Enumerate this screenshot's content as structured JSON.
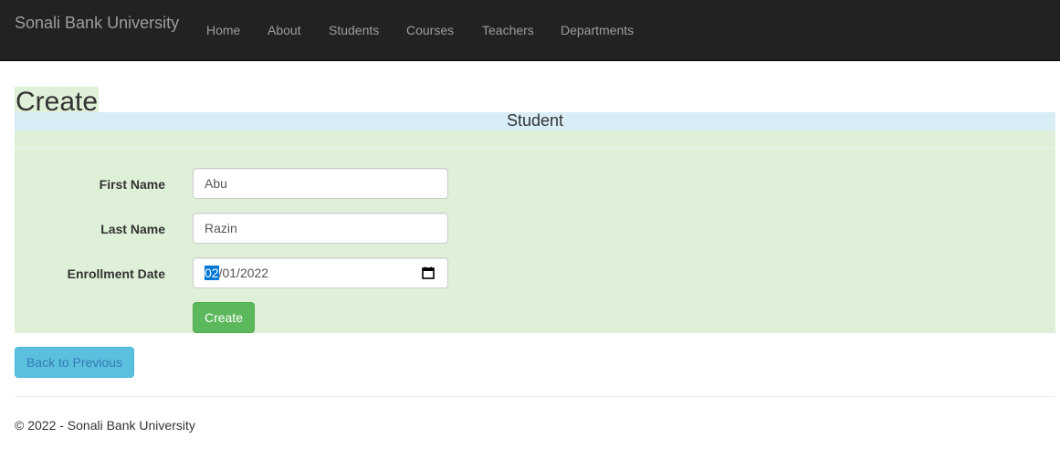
{
  "navbar": {
    "brand": "Sonali Bank University",
    "items": [
      "Home",
      "About",
      "Students",
      "Courses",
      "Teachers",
      "Departments"
    ]
  },
  "page": {
    "title": "Create",
    "panel_heading": "Student"
  },
  "form": {
    "first_name": {
      "label": "First Name",
      "value": "Abu"
    },
    "last_name": {
      "label": "Last Name",
      "value": "Razin"
    },
    "enrollment_date": {
      "label": "Enrollment Date",
      "month": "02",
      "sep": "/",
      "day": "01",
      "year": "2022"
    },
    "submit_label": "Create"
  },
  "back_label": "Back to Previous",
  "footer": {
    "text": "© 2022 - Sonali Bank University"
  },
  "colors": {
    "navbar": "#222222",
    "success": "#5cb85c",
    "info": "#5bc0de",
    "success_bg": "#dff0d8",
    "info_bg": "#d9edf7"
  }
}
